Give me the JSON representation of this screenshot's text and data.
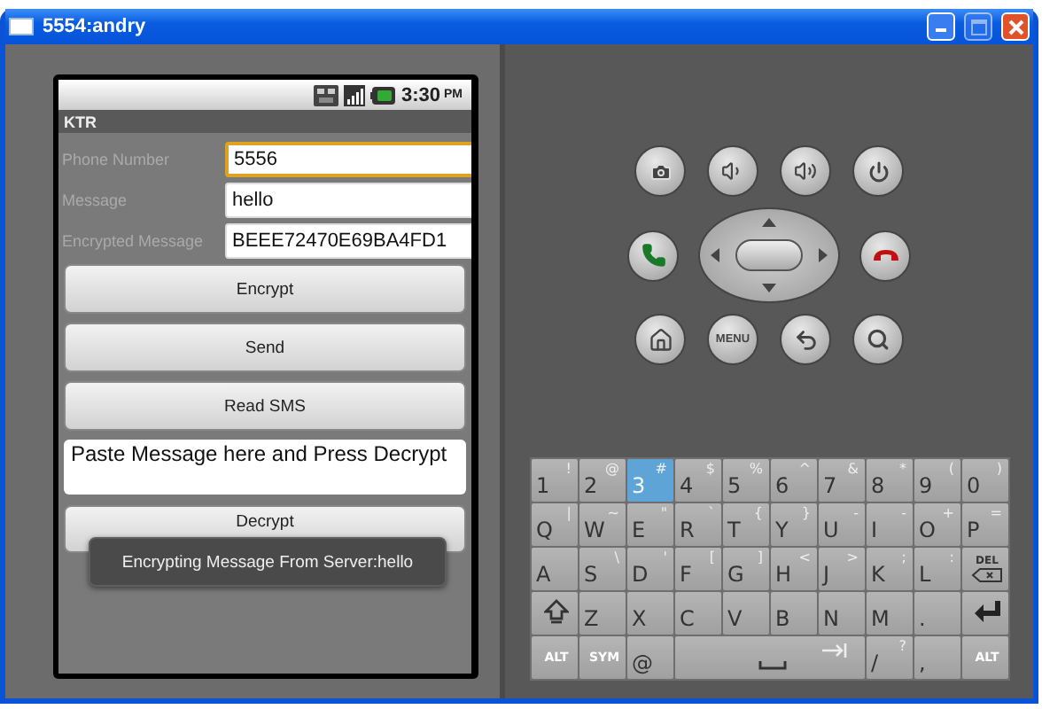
{
  "window": {
    "title": "5554:andry",
    "buttons": [
      {
        "kind": "minimize",
        "disabled": false
      },
      {
        "kind": "maximize",
        "disabled": true
      },
      {
        "kind": "close",
        "disabled": false
      }
    ]
  },
  "status_bar": {
    "time": "3:30",
    "ampm": "PM"
  },
  "app_title": "KTR",
  "form": [
    {
      "label": "Phone Number",
      "value": "5556",
      "focused": true
    },
    {
      "label": "Message",
      "value": "hello",
      "focused": false
    },
    {
      "label": "Encrypted Message",
      "value": "BEEE72470E69BA4FD1",
      "focused": false
    }
  ],
  "buttons_top": [
    "Encrypt",
    "Send",
    "Read SMS"
  ],
  "paste_field": {
    "value": "Paste Message here and Press Decrypt"
  },
  "decrypt_button": "Decrypt",
  "toast": "Encrypting Message From Server:hello",
  "hardware_rows": [
    [
      {
        "kind": "camera"
      },
      {
        "kind": "volume-down"
      },
      {
        "kind": "volume-up"
      },
      {
        "kind": "power"
      }
    ],
    [
      {
        "kind": "call"
      },
      {
        "kind": "dpad"
      },
      {
        "kind": "end-call"
      }
    ],
    [
      {
        "kind": "home"
      },
      {
        "kind": "menu",
        "label": "MENU"
      },
      {
        "kind": "back"
      },
      {
        "kind": "search"
      }
    ]
  ],
  "keyboard": [
    [
      {
        "kind": "char",
        "main": "1",
        "alt": "!",
        "selected": false
      },
      {
        "kind": "char",
        "main": "2",
        "alt": "@",
        "selected": false
      },
      {
        "kind": "char",
        "main": "3",
        "alt": "#",
        "selected": true
      },
      {
        "kind": "char",
        "main": "4",
        "alt": "$",
        "selected": false
      },
      {
        "kind": "char",
        "main": "5",
        "alt": "%",
        "selected": false
      },
      {
        "kind": "char",
        "main": "6",
        "alt": "^",
        "selected": false
      },
      {
        "kind": "char",
        "main": "7",
        "alt": "&",
        "selected": false
      },
      {
        "kind": "char",
        "main": "8",
        "alt": "*",
        "selected": false
      },
      {
        "kind": "char",
        "main": "9",
        "alt": "(",
        "selected": false
      },
      {
        "kind": "char",
        "main": "0",
        "alt": ")",
        "selected": false
      }
    ],
    [
      {
        "kind": "char",
        "main": "Q",
        "alt": "|",
        "selected": false
      },
      {
        "kind": "char",
        "main": "W",
        "alt": "~",
        "selected": false
      },
      {
        "kind": "char",
        "main": "E",
        "alt": "\"",
        "selected": false
      },
      {
        "kind": "char",
        "main": "R",
        "alt": "`",
        "selected": false
      },
      {
        "kind": "char",
        "main": "T",
        "alt": "{",
        "selected": false
      },
      {
        "kind": "char",
        "main": "Y",
        "alt": "}",
        "selected": false
      },
      {
        "kind": "char",
        "main": "U",
        "alt": "-",
        "selected": false
      },
      {
        "kind": "char",
        "main": "I",
        "alt": "-",
        "selected": false
      },
      {
        "kind": "char",
        "main": "O",
        "alt": "+",
        "selected": false
      },
      {
        "kind": "char",
        "main": "P",
        "alt": "=",
        "selected": false
      }
    ],
    [
      {
        "kind": "char",
        "main": "A",
        "selected": false
      },
      {
        "kind": "char",
        "main": "S",
        "alt": "\\",
        "selected": false
      },
      {
        "kind": "char",
        "main": "D",
        "alt": "'",
        "selected": false
      },
      {
        "kind": "char",
        "main": "F",
        "alt": "[",
        "selected": false
      },
      {
        "kind": "char",
        "main": "G",
        "alt": "]",
        "selected": false
      },
      {
        "kind": "char",
        "main": "H",
        "alt": "<",
        "selected": false
      },
      {
        "kind": "char",
        "main": "J",
        "alt": ">",
        "selected": false
      },
      {
        "kind": "char",
        "main": "K",
        "alt": ";",
        "selected": false
      },
      {
        "kind": "char",
        "main": "L",
        "alt": ":",
        "selected": false
      },
      {
        "kind": "del",
        "main": "DEL",
        "selected": false
      }
    ],
    [
      {
        "kind": "shift",
        "selected": false
      },
      {
        "kind": "char",
        "main": "Z",
        "selected": false
      },
      {
        "kind": "char",
        "main": "X",
        "selected": false
      },
      {
        "kind": "char",
        "main": "C",
        "selected": false
      },
      {
        "kind": "char",
        "main": "V",
        "selected": false
      },
      {
        "kind": "char",
        "main": "B",
        "selected": false
      },
      {
        "kind": "char",
        "main": "N",
        "selected": false
      },
      {
        "kind": "char",
        "main": "M",
        "selected": false
      },
      {
        "kind": "char",
        "main": ".",
        "selected": false
      },
      {
        "kind": "enter",
        "selected": false
      }
    ],
    [
      {
        "kind": "small",
        "main": "ALT",
        "selected": false
      },
      {
        "kind": "small",
        "main": "SYM",
        "selected": false
      },
      {
        "kind": "char",
        "main": "@",
        "selected": false
      },
      {
        "kind": "space",
        "selected": false
      },
      {
        "kind": "char",
        "main": "/",
        "alt": "?",
        "selected": false
      },
      {
        "kind": "char",
        "main": ",",
        "selected": false
      },
      {
        "kind": "small",
        "main": "ALT",
        "selected": false
      }
    ]
  ]
}
